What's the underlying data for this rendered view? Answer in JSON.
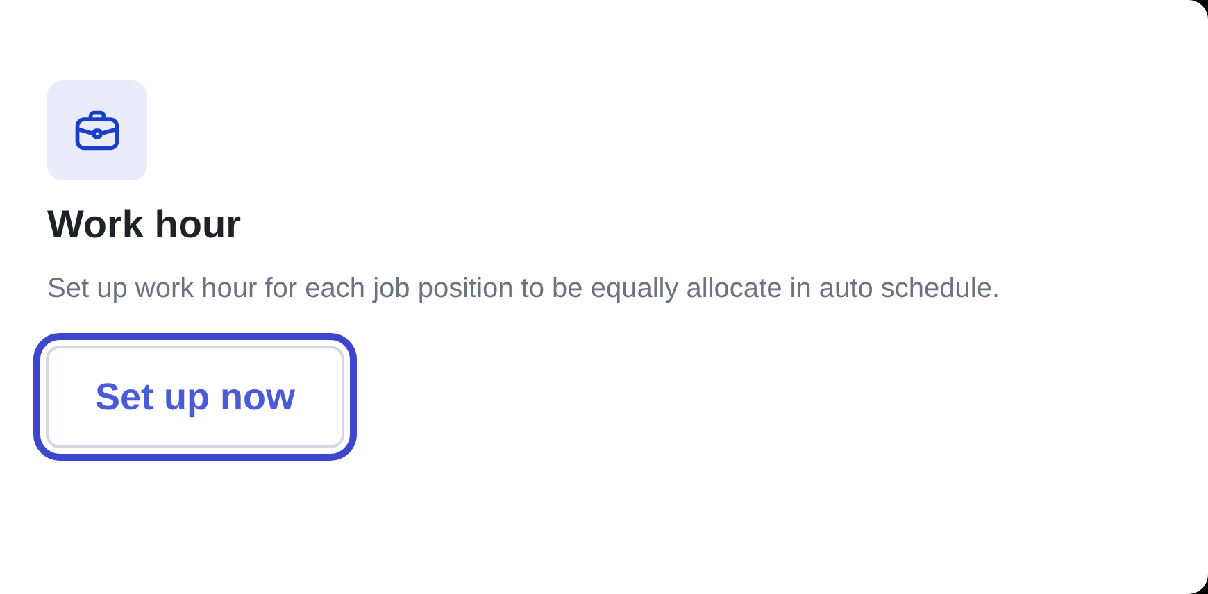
{
  "card": {
    "title": "Work hour",
    "description": "Set up work hour for each job position to be equally allocate in auto schedule.",
    "button": {
      "label": "Set up now",
      "focused": true
    }
  }
}
